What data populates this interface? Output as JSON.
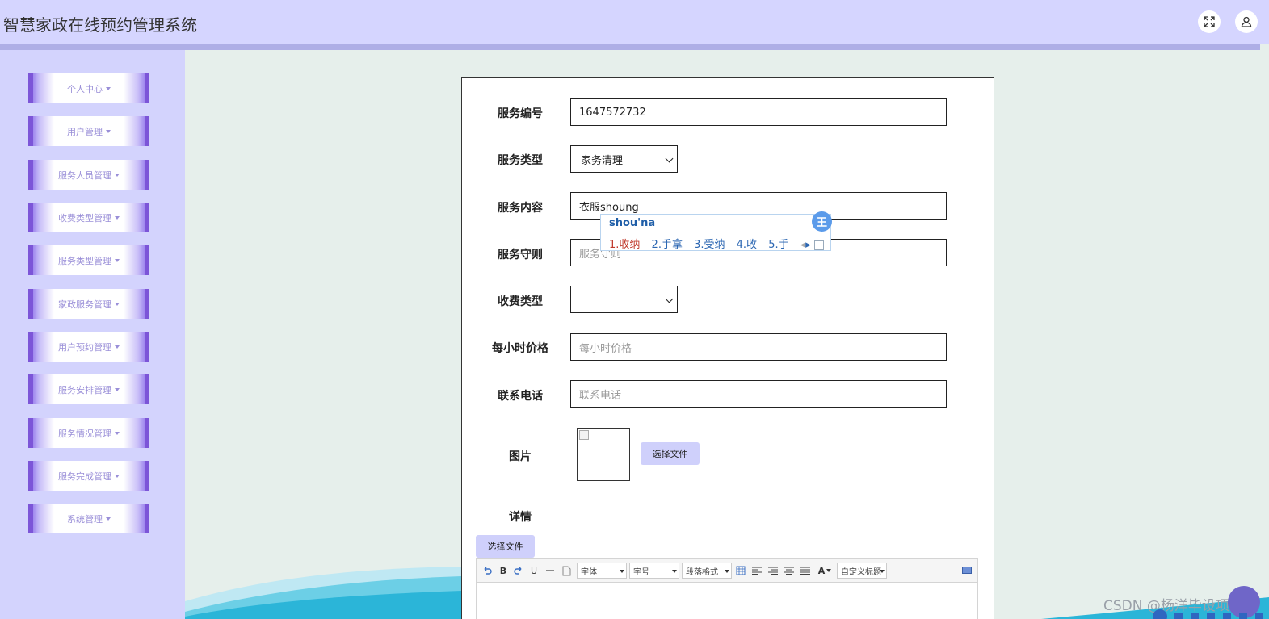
{
  "header": {
    "app_title": "智慧家政在线预约管理系统",
    "fullscreen_icon": "fullscreen-icon",
    "user_icon": "user-icon"
  },
  "sidebar": {
    "items": [
      {
        "label": "个人中心"
      },
      {
        "label": "用户管理"
      },
      {
        "label": "服务人员管理"
      },
      {
        "label": "收费类型管理"
      },
      {
        "label": "服务类型管理"
      },
      {
        "label": "家政服务管理"
      },
      {
        "label": "用户预约管理"
      },
      {
        "label": "服务安排管理"
      },
      {
        "label": "服务情况管理"
      },
      {
        "label": "服务完成管理"
      },
      {
        "label": "系统管理"
      }
    ]
  },
  "form": {
    "service_no": {
      "label": "服务编号",
      "value": "1647572732"
    },
    "service_type": {
      "label": "服务类型",
      "selected": "家务清理"
    },
    "service_content": {
      "label": "服务内容",
      "value": "衣服shoung"
    },
    "service_rules": {
      "label": "服务守则",
      "placeholder": "服务守则"
    },
    "fee_type": {
      "label": "收费类型",
      "selected": ""
    },
    "hourly_price": {
      "label": "每小时价格",
      "placeholder": "每小时价格"
    },
    "phone": {
      "label": "联系电话",
      "placeholder": "联系电话"
    },
    "image": {
      "label": "图片",
      "button": "选择文件"
    },
    "details": {
      "label": "详情",
      "button": "选择文件"
    }
  },
  "editor_toolbar": {
    "bold": "B",
    "underline": "U",
    "font_combo": "字体",
    "size_combo": "字号",
    "para_combo": "段落格式",
    "font_color": "A",
    "custom_title": "自定义标题"
  },
  "ime": {
    "composition": "shou'na",
    "candidates": [
      "1.收纳",
      "2.手拿",
      "3.受纳",
      "4.收",
      "5.手"
    ],
    "badge": "王"
  },
  "watermark": "CSDN @杨洋毕设项目"
}
